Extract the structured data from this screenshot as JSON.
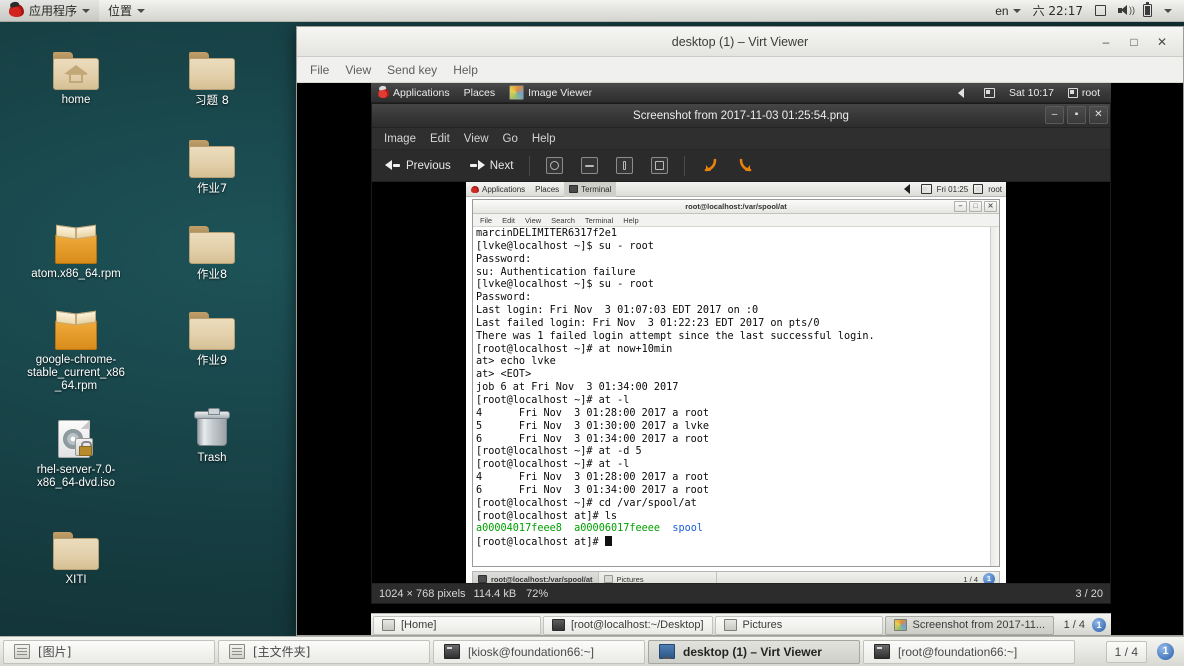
{
  "host": {
    "top_panel": {
      "applications_label": "应用程序",
      "places_label": "位置",
      "keyboard_layout": "en",
      "clock": "六 22:17",
      "icons": [
        "redhat-logo-icon",
        "caret-down-icon",
        "screen-icon",
        "volume-icon",
        "battery-icon"
      ]
    },
    "desktop_icons": [
      {
        "name": "home",
        "label": "home",
        "type": "home-folder"
      },
      {
        "name": "xiti8",
        "label": "习题  8",
        "type": "folder"
      },
      {
        "name": "zuoye7",
        "label": "作业7",
        "type": "folder"
      },
      {
        "name": "atom",
        "label": "atom.x86_64.rpm",
        "type": "rpm"
      },
      {
        "name": "zuoye8",
        "label": "作业8",
        "type": "folder"
      },
      {
        "name": "chrome",
        "label": "google-chrome-stable_current_x86_64.rpm",
        "type": "rpm"
      },
      {
        "name": "zuoye9",
        "label": "作业9",
        "type": "folder"
      },
      {
        "name": "rhel-iso",
        "label": "rhel-server-7.0-x86_64-dvd.iso",
        "type": "iso"
      },
      {
        "name": "trash",
        "label": "Trash",
        "type": "trash"
      },
      {
        "name": "xiti",
        "label": "XITI",
        "type": "folder"
      }
    ],
    "taskbar": {
      "items": [
        {
          "label": "[图片]",
          "icon": "files-icon",
          "active": false
        },
        {
          "label": "[主文件夹]",
          "icon": "files-icon",
          "active": false
        },
        {
          "label": "[kiosk@foundation66:~]",
          "icon": "terminal-icon",
          "active": false
        },
        {
          "label": "desktop (1) – Virt Viewer",
          "icon": "monitor-icon",
          "active": true
        },
        {
          "label": "[root@foundation66:~]",
          "icon": "terminal-icon",
          "active": false
        }
      ],
      "pager": "1 / 4",
      "workspace_badge": "1"
    }
  },
  "virt_viewer": {
    "title": "desktop (1) – Virt Viewer",
    "window_buttons": [
      "minimize",
      "maximize",
      "close"
    ],
    "window_button_glyphs": {
      "minimize": "–",
      "maximize": "□",
      "close": "✕"
    },
    "menu": [
      "File",
      "View",
      "Send key",
      "Help"
    ]
  },
  "vm": {
    "top_panel": {
      "applications_label": "Applications",
      "places_label": "Places",
      "window_title": "Image Viewer",
      "clock": "Sat 10:17",
      "user": "root"
    },
    "taskbar": {
      "items": [
        {
          "label": "[Home]",
          "icon": "files-icon",
          "active": false
        },
        {
          "label": "[root@localhost:~/Desktop]",
          "icon": "terminal-icon",
          "active": false
        },
        {
          "label": "Pictures",
          "icon": "files-icon",
          "active": false
        },
        {
          "label": "Screenshot from 2017-11...",
          "icon": "image-viewer-icon",
          "active": true
        }
      ],
      "pager": "1 / 4",
      "workspace_badge": "1"
    }
  },
  "image_viewer": {
    "title": "Screenshot from 2017-11-03 01:25:54.png",
    "menu": [
      "Image",
      "Edit",
      "View",
      "Go",
      "Help"
    ],
    "toolbar": {
      "previous_label": "Previous",
      "next_label": "Next",
      "zoom_buttons": [
        "zoom-in-icon",
        "zoom-out-icon",
        "zoom-normal-icon",
        "zoom-fit-icon"
      ],
      "rotate_buttons": [
        "rotate-counterclockwise-icon",
        "rotate-clockwise-icon"
      ]
    },
    "statusbar": {
      "dimensions": "1024 × 768 pixels",
      "filesize": "114.4 kB",
      "zoom": "72%",
      "position": "3 / 20"
    },
    "window_buttons": {
      "minimize": "–",
      "maximize": "▪",
      "close": "✕"
    }
  },
  "inner_screenshot": {
    "top_panel": {
      "applications_label": "Applications",
      "places_label": "Places",
      "window_title": "Terminal",
      "clock": "Fri 01:25",
      "user": "root"
    },
    "terminal": {
      "title": "root@localhost:/var/spool/at",
      "menu": [
        "File",
        "Edit",
        "View",
        "Search",
        "Terminal",
        "Help"
      ],
      "window_buttons": {
        "minimize": "–",
        "maximize": "□",
        "close": "✕"
      },
      "lines": [
        "marcinDELIMITER6317f2e1",
        "[lvke@localhost ~]$ su - root",
        "Password:",
        "su: Authentication failure",
        "[lvke@localhost ~]$ su - root",
        "Password:",
        "Last login: Fri Nov  3 01:07:03 EDT 2017 on :0",
        "Last failed login: Fri Nov  3 01:22:23 EDT 2017 on pts/0",
        "There was 1 failed login attempt since the last successful login.",
        "[root@localhost ~]# at now+10min",
        "at> echo lvke",
        "at> <EOT>",
        "job 6 at Fri Nov  3 01:34:00 2017",
        "[root@localhost ~]# at -l",
        "4\tFri Nov  3 01:28:00 2017 a root",
        "5\tFri Nov  3 01:30:00 2017 a lvke",
        "6\tFri Nov  3 01:34:00 2017 a root",
        "[root@localhost ~]# at -d 5",
        "[root@localhost ~]# at -l",
        "4\tFri Nov  3 01:28:00 2017 a root",
        "6\tFri Nov  3 01:34:00 2017 a root",
        "[root@localhost ~]# cd /var/spool/at",
        "[root@localhost at]# ls"
      ],
      "ls_output": {
        "file1": "a00004017feee8",
        "file2": "a00006017feeee",
        "dir1": "spool"
      },
      "prompt_last": "[root@localhost at]# ",
      "colors": {
        "file_green": "#00a000",
        "dir_blue": "#1b5fd6"
      }
    },
    "taskbar": {
      "items": [
        {
          "label": "root@localhost:/var/spool/at",
          "active": true
        },
        {
          "label": "Pictures",
          "active": false
        }
      ],
      "pager": "1 / 4",
      "workspace_badge": "1"
    }
  }
}
